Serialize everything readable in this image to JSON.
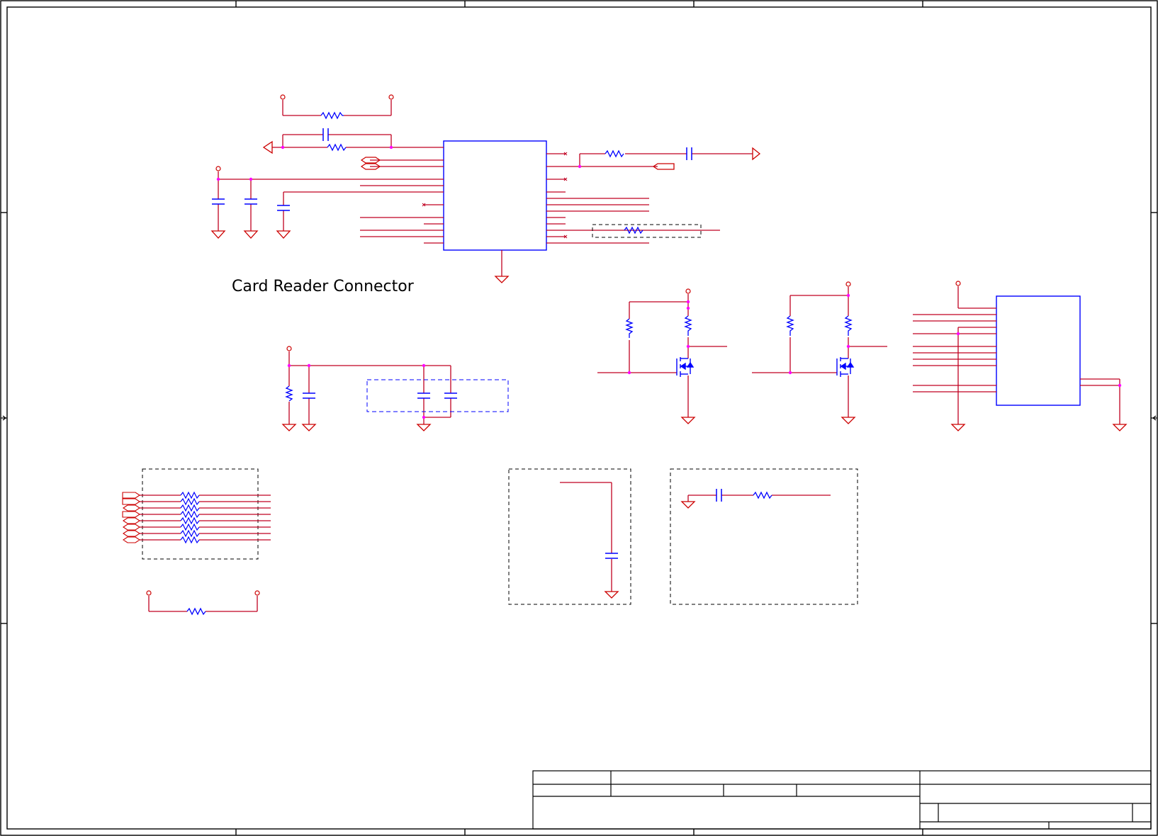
{
  "sheet": {
    "section_title": "Card Reader Connector"
  },
  "colors": {
    "wire": "#c00020",
    "component": "#0000ff",
    "junction": "#ff00ff",
    "frame": "#000000",
    "power": "#cc0000"
  },
  "icons": {
    "resistor": "resistor-icon",
    "capacitor": "capacitor-icon",
    "ground": "ground-icon",
    "power_pin": "power-pin-icon",
    "mosfet": "mosfet-icon",
    "offpage_connector": "offpage-connector-icon"
  }
}
